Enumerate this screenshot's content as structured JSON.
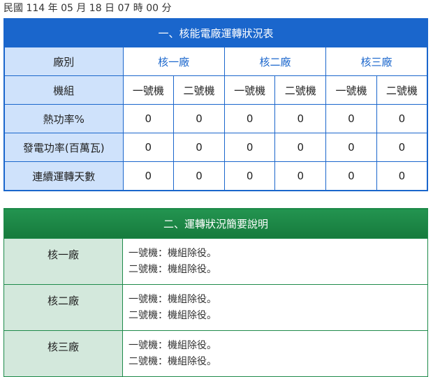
{
  "timestamp": "民國 114 年 05 月 18 日 07 時 00 分",
  "table1": {
    "title": "一、核能電廠運轉狀況表",
    "plant_row_label": "廠別",
    "unit_row_label": "機組",
    "plants": [
      "核一廠",
      "核二廠",
      "核三廠"
    ],
    "units": [
      "一號機",
      "二號機",
      "一號機",
      "二號機",
      "一號機",
      "二號機"
    ],
    "rows": [
      {
        "label": "熱功率%",
        "values": [
          "0",
          "0",
          "0",
          "0",
          "0",
          "0"
        ]
      },
      {
        "label": "發電功率(百萬瓦)",
        "values": [
          "0",
          "0",
          "0",
          "0",
          "0",
          "0"
        ]
      },
      {
        "label": "連續運轉天數",
        "values": [
          "0",
          "0",
          "0",
          "0",
          "0",
          "0"
        ]
      }
    ]
  },
  "table2": {
    "title": "二、運轉狀況簡要說明",
    "rows": [
      {
        "plant": "核一廠",
        "lines": [
          "一號機：機組除役。",
          "二號機：機組除役。"
        ]
      },
      {
        "plant": "核二廠",
        "lines": [
          "一號機：機組除役。",
          "二號機：機組除役。"
        ]
      },
      {
        "plant": "核三廠",
        "lines": [
          "一號機：機組除役。",
          "二號機：機組除役。"
        ]
      }
    ]
  },
  "colors": {
    "blue": "#1a66cc",
    "light_blue": "#cfe2fb",
    "green": "#1e8a4a",
    "light_green": "#d3e8dc"
  }
}
